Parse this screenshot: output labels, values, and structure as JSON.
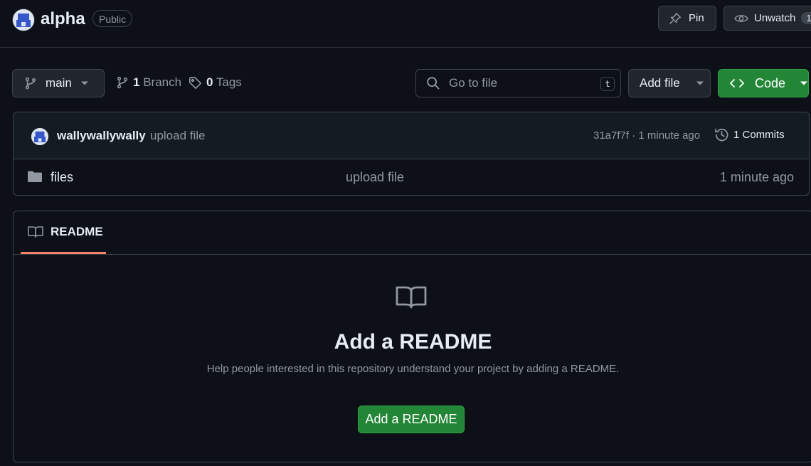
{
  "repo": {
    "name": "alpha",
    "visibility": "Public",
    "pin_label": "Pin",
    "unwatch_label": "Unwatch",
    "watch_count": "1"
  },
  "toolbar": {
    "branch_name": "main",
    "branch_count": "1",
    "branch_label": "Branch",
    "tag_count": "0",
    "tag_label": "Tags",
    "search_placeholder": "Go to file",
    "search_shortcut": "t",
    "add_file_label": "Add file",
    "code_label": "Code"
  },
  "latest_commit": {
    "author": "wallywallywally",
    "message": "upload file",
    "meta": "31a7f7f · 1 minute ago",
    "commits_label": "1 Commits"
  },
  "files": [
    {
      "name": "files",
      "commit_message": "upload file",
      "age": "1 minute ago",
      "icon": "folder-icon"
    }
  ],
  "readme": {
    "tab_label": "README",
    "blank_title": "Add a README",
    "blank_description": "Help people interested in this repository understand your project by adding a README.",
    "add_button_label": "Add a README"
  },
  "colors": {
    "background": "#0d1117",
    "primary_button": "#238636",
    "tab_underline": "#f78166"
  }
}
